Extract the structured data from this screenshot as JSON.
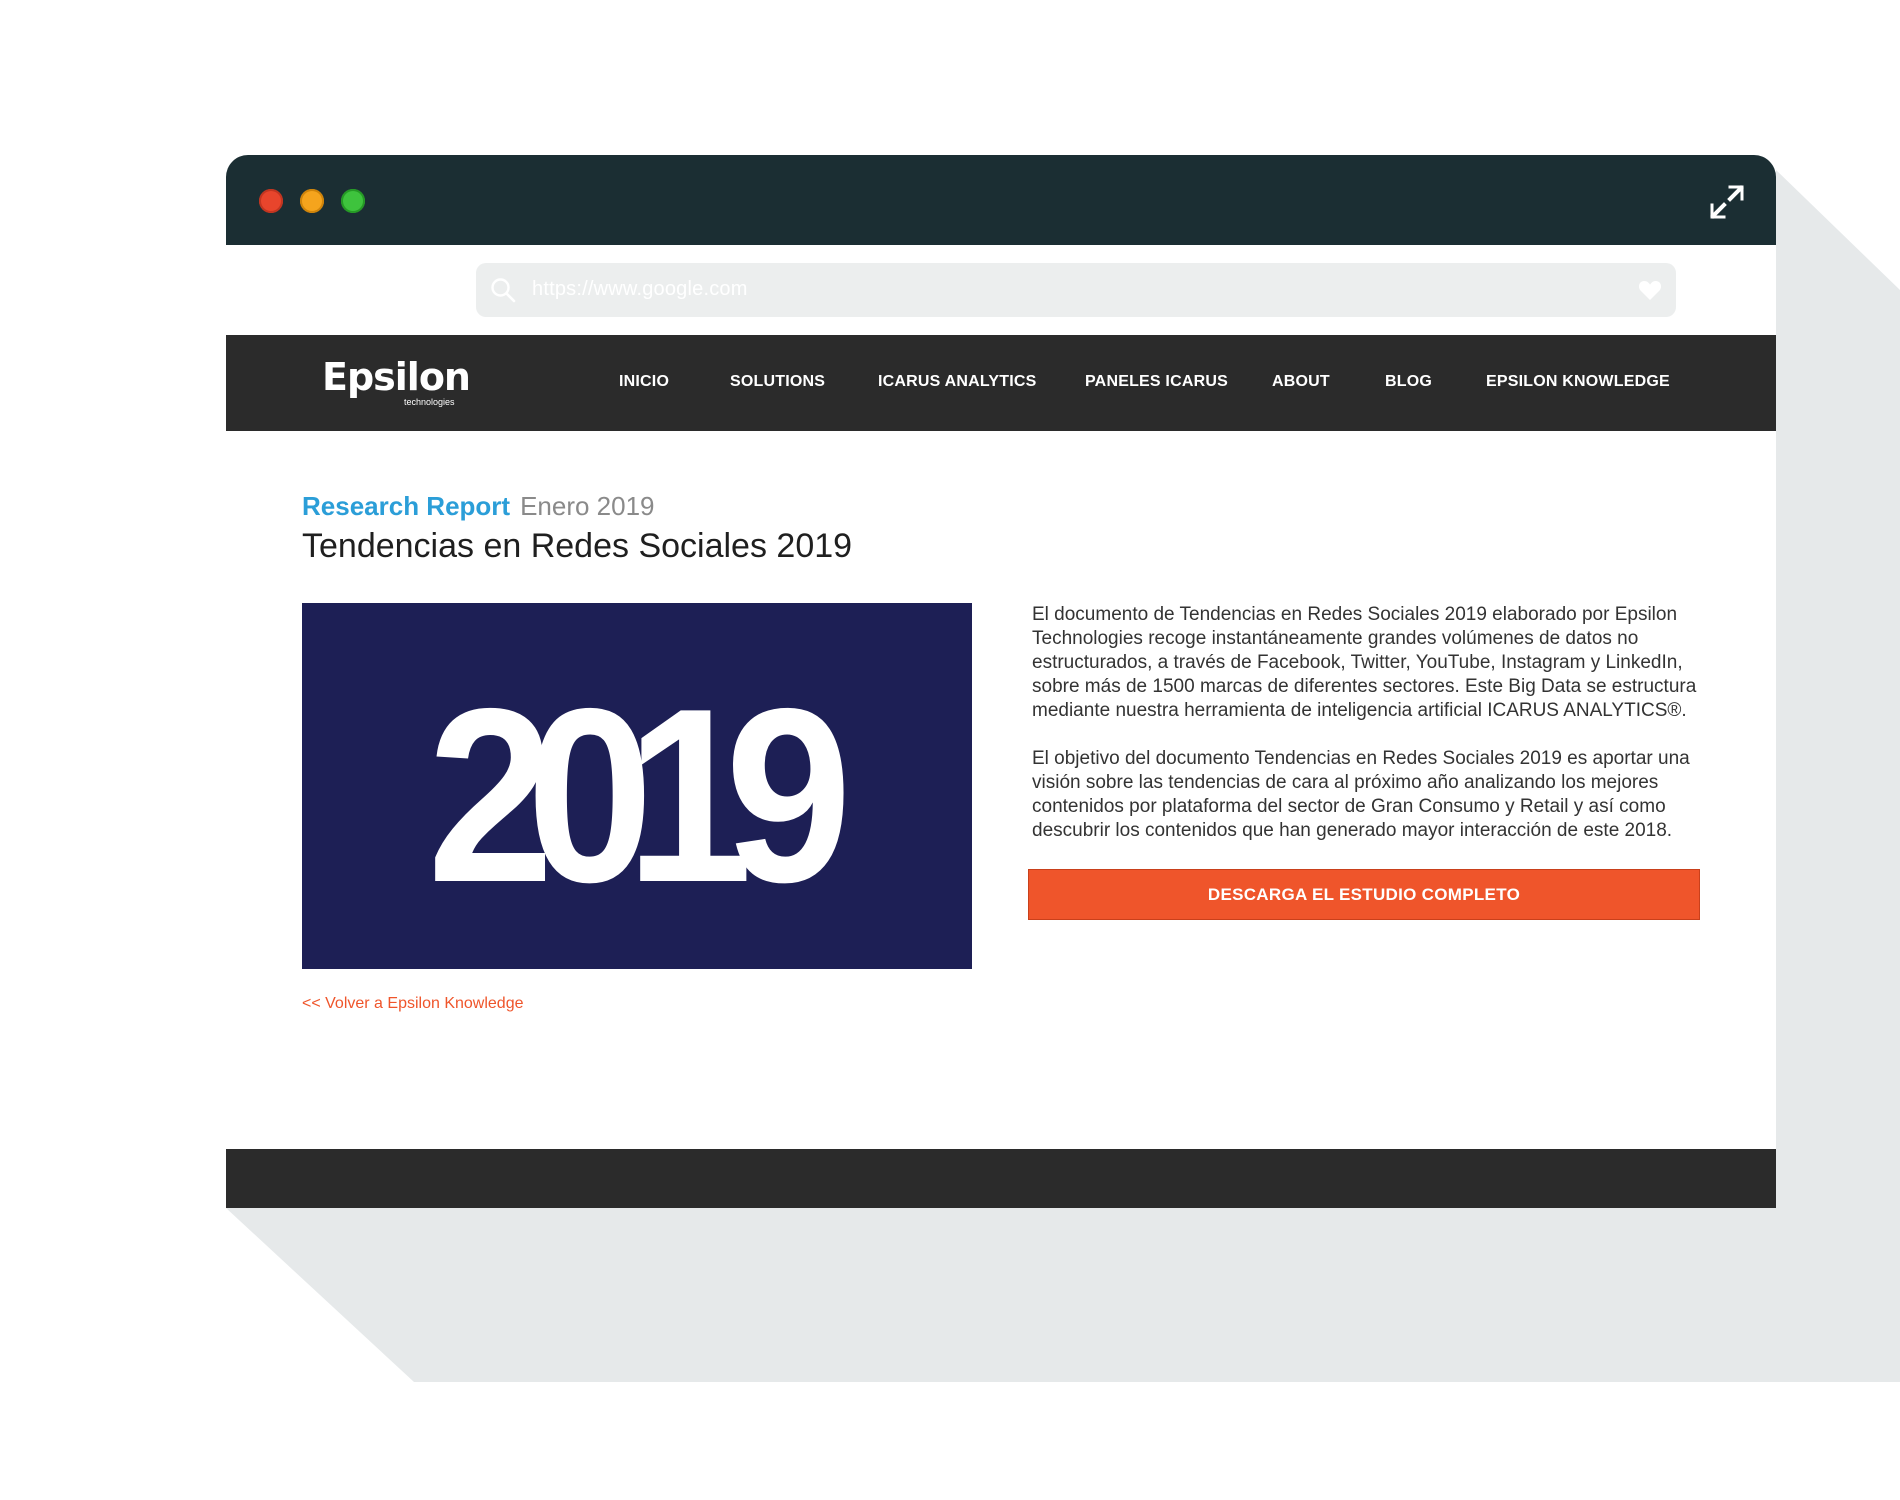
{
  "browser": {
    "url": "https://www.google.com",
    "icons": {
      "search": "search-icon",
      "favorite": "heart-icon",
      "expand": "expand-icon"
    },
    "window_buttons": [
      "close",
      "minimize",
      "maximize"
    ]
  },
  "site": {
    "logo": {
      "main": "Epsilon",
      "sub": "technologies"
    },
    "nav": [
      {
        "label": "INICIO"
      },
      {
        "label": "SOLUTIONS"
      },
      {
        "label": "ICARUS ANALYTICS"
      },
      {
        "label": "PANELES ICARUS"
      },
      {
        "label": "ABOUT"
      },
      {
        "label": "BLOG"
      },
      {
        "label": "EPSILON KNOWLEDGE"
      }
    ]
  },
  "article": {
    "kind": "Research Report",
    "date": "Enero 2019",
    "title": "Tendencias en Redes Sociales 2019",
    "hero_text": "2019",
    "paragraphs": [
      "El documento de Tendencias en Redes Sociales 2019 elaborado por Epsilon Technologies recoge instantáneamente grandes volúmenes de datos no estructurados, a través de Facebook, Twitter, YouTube, Instagram y LinkedIn, sobre más de 1500 marcas de diferentes sectores. Este Big Data se estructura mediante nuestra herramienta de inteligencia artificial ICARUS ANALYTICS®.",
      "El objetivo del documento Tendencias en Redes Sociales 2019 es aportar una visión sobre las tendencias de cara al próximo año analizando los mejores contenidos por plataforma del sector de Gran Consumo y Retail y así como descubrir los contenidos que han generado mayor interacción de este 2018."
    ],
    "cta_label": "DESCARGA EL ESTUDIO COMPLETO",
    "back_link": "<< Volver a Epsilon Knowledge"
  },
  "colors": {
    "titlebar": "#1b2e33",
    "nav_bg": "#2b2b2b",
    "accent_blue": "#2b9ed8",
    "accent_orange": "#ef552b",
    "hero_bg": "#1d1f55",
    "shadow": "#e6e9ea"
  }
}
